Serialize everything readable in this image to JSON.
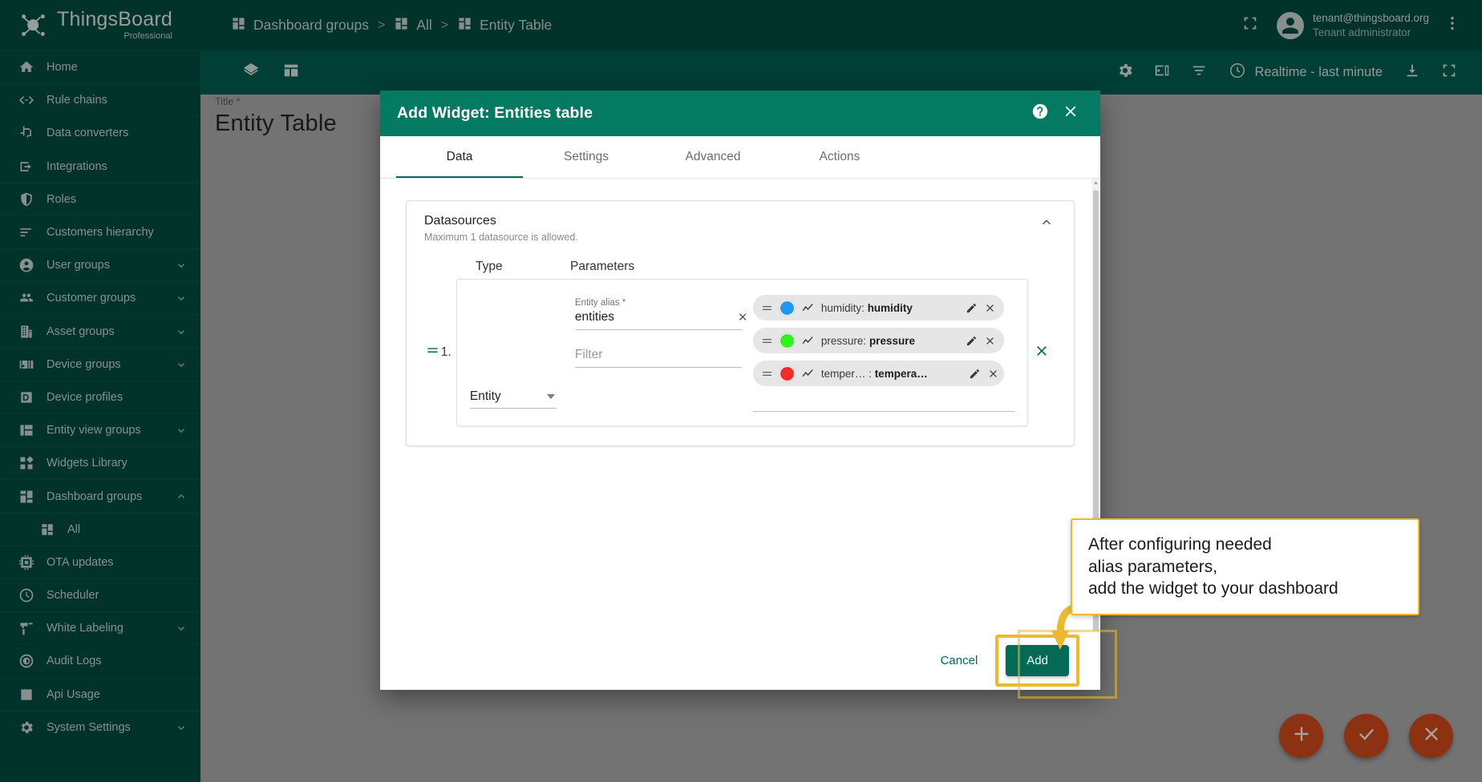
{
  "brand": {
    "name": "ThingsBoard",
    "edition": "Professional",
    "logo_icon": "thingsboard-logo-icon"
  },
  "sidebar": {
    "items": [
      {
        "label": "Home",
        "icon": "home-icon",
        "expandable": false,
        "sub": false
      },
      {
        "label": "Rule chains",
        "icon": "rule-chains-icon",
        "expandable": false,
        "sub": false
      },
      {
        "label": "Data converters",
        "icon": "data-converters-icon",
        "expandable": false,
        "sub": false
      },
      {
        "label": "Integrations",
        "icon": "integrations-icon",
        "expandable": false,
        "sub": false
      },
      {
        "label": "Roles",
        "icon": "shield-icon",
        "expandable": false,
        "sub": false
      },
      {
        "label": "Customers hierarchy",
        "icon": "hierarchy-icon",
        "expandable": false,
        "sub": false
      },
      {
        "label": "User groups",
        "icon": "user-icon",
        "expandable": true,
        "expanded": false,
        "sub": false
      },
      {
        "label": "Customer groups",
        "icon": "people-icon",
        "expandable": true,
        "expanded": false,
        "sub": false
      },
      {
        "label": "Asset groups",
        "icon": "building-icon",
        "expandable": true,
        "expanded": false,
        "sub": false
      },
      {
        "label": "Device groups",
        "icon": "device-icon",
        "expandable": true,
        "expanded": false,
        "sub": false
      },
      {
        "label": "Device profiles",
        "icon": "device-profile-icon",
        "expandable": false,
        "sub": false
      },
      {
        "label": "Entity view groups",
        "icon": "entity-view-icon",
        "expandable": true,
        "expanded": false,
        "sub": false
      },
      {
        "label": "Widgets Library",
        "icon": "widgets-library-icon",
        "expandable": false,
        "sub": false
      },
      {
        "label": "Dashboard groups",
        "icon": "dashboard-icon",
        "expandable": true,
        "expanded": true,
        "sub": false
      },
      {
        "label": "All",
        "icon": "dashboard-icon",
        "expandable": false,
        "sub": true
      },
      {
        "label": "OTA updates",
        "icon": "ota-chip-icon",
        "expandable": false,
        "sub": false
      },
      {
        "label": "Scheduler",
        "icon": "clock-icon",
        "expandable": false,
        "sub": false
      },
      {
        "label": "White Labeling",
        "icon": "brush-icon",
        "expandable": true,
        "expanded": false,
        "sub": false
      },
      {
        "label": "Audit Logs",
        "icon": "audit-logs-icon",
        "expandable": false,
        "sub": false
      },
      {
        "label": "Api Usage",
        "icon": "bar-chart-icon",
        "expandable": false,
        "sub": false
      },
      {
        "label": "System Settings",
        "icon": "gear-icon",
        "expandable": true,
        "expanded": false,
        "sub": false
      }
    ]
  },
  "topbar": {
    "breadcrumb": [
      {
        "label": "Dashboard groups",
        "icon": "dashboard-icon"
      },
      {
        "label": "All",
        "icon": "dashboard-icon"
      },
      {
        "label": "Entity Table",
        "icon": "dashboard-icon"
      }
    ],
    "separator": ">",
    "fullscreen_icon": "fullscreen-icon",
    "user": {
      "email": "tenant@thingsboard.org",
      "role": "Tenant administrator",
      "avatar_icon": "account-circle-icon"
    },
    "more_icon": "more-vert-icon"
  },
  "dashboard_toolbar": {
    "left_icons": [
      {
        "name": "layers-icon"
      },
      {
        "name": "dashboard-layout-icon"
      }
    ],
    "right_icons": [
      {
        "name": "gear-icon"
      },
      {
        "name": "devices-icon"
      },
      {
        "name": "filters-icon"
      }
    ],
    "time_range": {
      "label": "Realtime - last minute",
      "icon": "clock-icon"
    },
    "download_icon": "download-icon",
    "expand_icon": "fullscreen-icon"
  },
  "canvas": {
    "widget_title_label": "Title *",
    "widget_title_value": "Entity Table",
    "fabs": [
      {
        "name": "add-fab",
        "icon": "plus-icon"
      },
      {
        "name": "apply-fab",
        "icon": "check-icon"
      },
      {
        "name": "discard-fab",
        "icon": "close-icon"
      }
    ],
    "fab_color": "#c1441a"
  },
  "dialog": {
    "title": "Add Widget: Entities table",
    "help_icon": "help-icon",
    "close_icon": "close-icon",
    "header_color": "#047a63",
    "tabs": [
      {
        "label": "Data",
        "active": true
      },
      {
        "label": "Settings",
        "active": false
      },
      {
        "label": "Advanced",
        "active": false
      },
      {
        "label": "Actions",
        "active": false
      }
    ],
    "datasources": {
      "title": "Datasources",
      "subtitle": "Maximum 1 datasource is allowed.",
      "collapse_icon": "chevron-up-icon",
      "columns": {
        "type": "Type",
        "parameters": "Parameters"
      },
      "rows": [
        {
          "index": "1.",
          "drag_icon": "drag-handle-icon",
          "type_value": "Entity",
          "alias_label": "Entity alias *",
          "alias_value": "entities",
          "alias_clear_icon": "clear-icon",
          "filter_placeholder": "Filter",
          "remove_icon": "close-icon",
          "data_keys": [
            {
              "color": "#2196f3",
              "type_icon": "timeseries-icon",
              "label": "humidity:",
              "value": "humidity",
              "edit_icon": "pencil-icon",
              "remove_icon": "close-icon",
              "drag_icon": "drag-handle-icon"
            },
            {
              "color": "#2ff21f",
              "type_icon": "timeseries-icon",
              "label": "pressure:",
              "value": "pressure",
              "edit_icon": "pencil-icon",
              "remove_icon": "close-icon",
              "drag_icon": "drag-handle-icon"
            },
            {
              "color": "#f42b2b",
              "type_icon": "timeseries-icon",
              "label": "temper… :",
              "value": "tempera…",
              "edit_icon": "pencil-icon",
              "remove_icon": "close-icon",
              "drag_icon": "drag-handle-icon"
            }
          ]
        }
      ]
    },
    "actions": {
      "cancel_label": "Cancel",
      "add_label": "Add",
      "add_color": "#046a55",
      "highlight_color": "#edb92e"
    }
  },
  "callout": {
    "lines": [
      "After configuring needed",
      "alias parameters,",
      "add the widget to your dashboard"
    ],
    "border_color": "#edb92e",
    "arrow_icon": "curved-arrow-icon"
  }
}
